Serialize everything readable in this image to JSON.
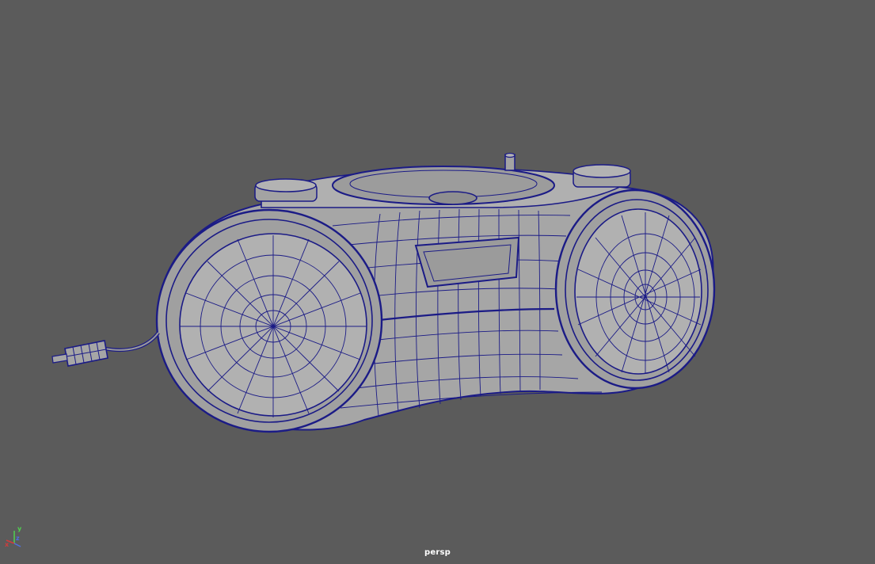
{
  "viewport": {
    "camera_name": "persp",
    "background_color": "#5b5b5b",
    "wireframe_color": "#1b1b86",
    "shaded_color": "#a9a9a9"
  },
  "axis_gizmo": {
    "x_label": "x",
    "y_label": "y",
    "z_label": "z",
    "x_color": "#d23c3c",
    "y_color": "#4fd24f",
    "z_color": "#4f6fe0"
  },
  "model": {
    "subject": "boombox-mesh"
  }
}
